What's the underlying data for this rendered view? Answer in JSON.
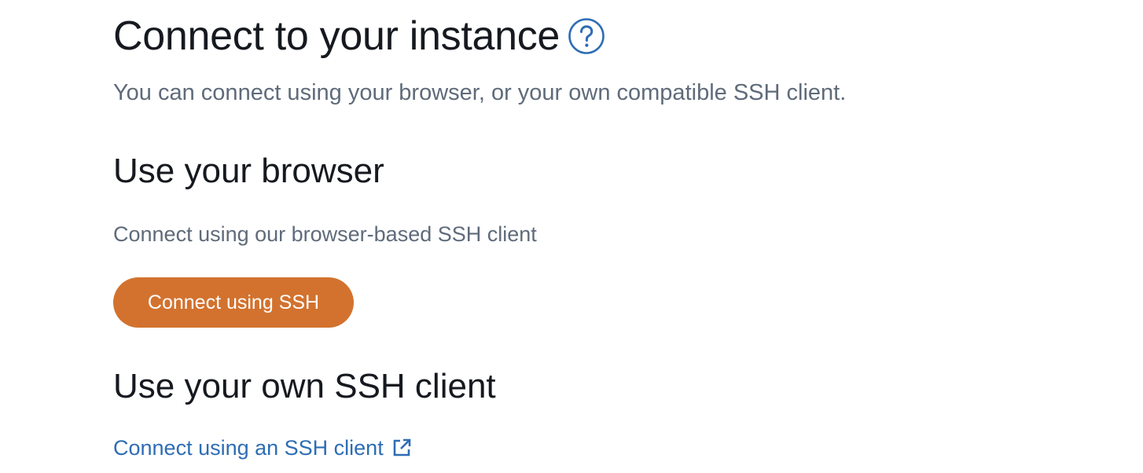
{
  "header": {
    "title": "Connect to your instance",
    "help_icon": "help-circle-icon",
    "subtitle": "You can connect using your browser, or your own compatible SSH client."
  },
  "browser_section": {
    "heading": "Use your browser",
    "description": "Connect using our browser-based SSH client",
    "button_label": "Connect using SSH"
  },
  "own_client_section": {
    "heading": "Use your own SSH client",
    "link_label": "Connect using an SSH client",
    "link_icon": "external-link-icon"
  },
  "colors": {
    "primary_button": "#d2722e",
    "link": "#2e6db4",
    "heading_text": "#16191f",
    "secondary_text": "#5f6b7a"
  }
}
